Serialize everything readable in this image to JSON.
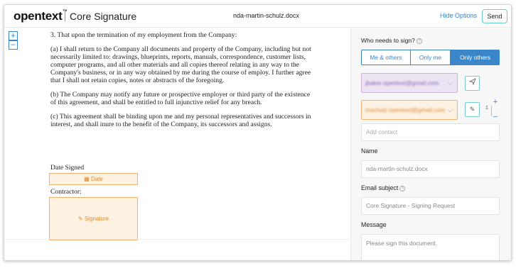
{
  "header": {
    "brand": "opentext",
    "product": "Core Signature",
    "doc_title": "nda-martin-schulz.docx",
    "hide_options": "Hide Options",
    "send": "Send"
  },
  "document": {
    "zoom_in": "+",
    "zoom_out": "−",
    "paragraphs": [
      "3. That upon the termination of my employment from the Company:",
      "(a) I shall return to the Company all documents and property of the Company, including but not necessarily limited to: drawings, blueprints, reports, manuals, correspondence, customer lists, computer programs, and all other materials and all copies thereof relating in any way to the Company's business, or in any way obtained by me during the course of employ. I further agree that I shall not retain copies, notes or abstracts of the foregoing.",
      "(b) The Company may notify any future or prospective employer or third party of the existence of this agreement, and shall be entitled to full injunctive relief for any breach.",
      "(c) This agreement shall be binding upon me and my personal representatives and successors in interest, and shall inure to the benefit of the Company, its successors and assigns."
    ],
    "date_signed_label": "Date Signed",
    "date_field": "Date",
    "contractor_label": "Contractor:",
    "signature_field": "Signature"
  },
  "panel": {
    "who_label": "Who needs to sign?",
    "options": [
      "Me & others",
      "Only me",
      "Only others"
    ],
    "selected_option": "Only others",
    "recipients": [
      {
        "email": "jbaker.opentext@gmail.com",
        "color": "#8a62b0",
        "action_icon": "send-icon"
      },
      {
        "email": "mschulz.opentext@gmail.com",
        "color": "#d88a30",
        "action_icon": "pen-icon"
      }
    ],
    "signing_order": "1",
    "add_contact_placeholder": "Add contact",
    "name_label": "Name",
    "name_value": "nda-martin-schulz.docx",
    "subject_label": "Email subject",
    "subject_value": "Core Signature - Signing Request",
    "message_label": "Message",
    "message_value": "Please sign this document."
  },
  "colors": {
    "accent": "#3a86c8",
    "signer1": "#ede4f3",
    "signer2": "#fdf1e2"
  }
}
